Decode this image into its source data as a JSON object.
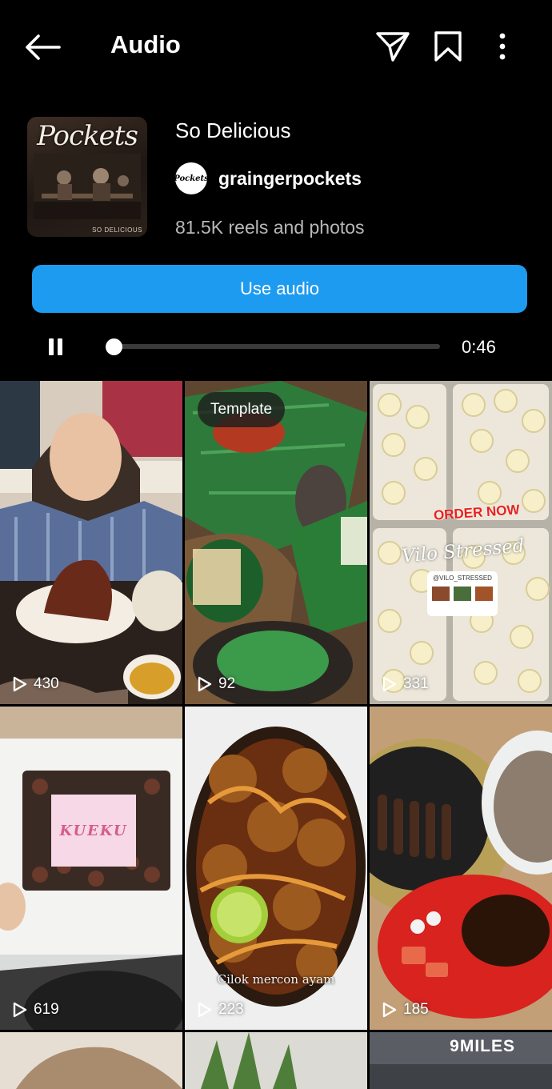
{
  "header": {
    "title": "Audio",
    "back_icon": "arrow-left-icon",
    "send_icon": "paper-plane-icon",
    "save_icon": "bookmark-icon",
    "more_icon": "more-vertical-icon"
  },
  "audio": {
    "cover_logo": "Pockets",
    "cover_subtitle": "SO DELICIOUS",
    "title": "So Delicious",
    "artist": "graingerpockets",
    "artist_avatar_text": "Pockets",
    "count_text": "81.5K reels and photos",
    "use_button_label": "Use audio",
    "accent_color": "#1d9bf0"
  },
  "player": {
    "state_icon": "pause-icon",
    "progress": 0.01,
    "duration": "0:46"
  },
  "grid": [
    {
      "plays": "430"
    },
    {
      "plays": "92",
      "badge": "Template"
    },
    {
      "plays": "331",
      "order_text": "ORDER NOW",
      "script_text": "Vilo Stressed",
      "handle": "@VILO_STRESSED"
    },
    {
      "plays": "619",
      "box_text": "KUEKU"
    },
    {
      "plays": "223",
      "caption": "Cilok mercon ayam"
    },
    {
      "plays": "185"
    },
    {},
    {},
    {
      "logo": "9MILES"
    }
  ]
}
